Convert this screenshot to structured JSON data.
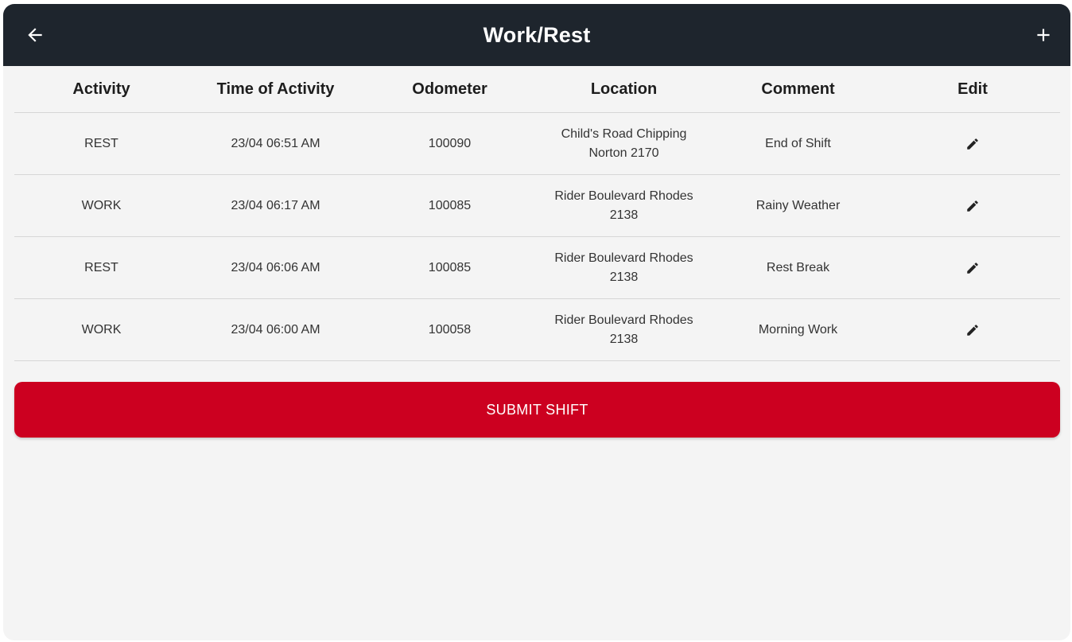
{
  "appbar": {
    "title": "Work/Rest",
    "back_icon": "arrow-left-icon",
    "add_icon": "plus-icon"
  },
  "table": {
    "columns": [
      "Activity",
      "Time of Activity",
      "Odometer",
      "Location",
      "Comment",
      "Edit"
    ],
    "rows": [
      {
        "activity": "REST",
        "time": "23/04 06:51 AM",
        "odometer": "100090",
        "location": "Child's Road Chipping Norton 2170",
        "comment": "End of Shift"
      },
      {
        "activity": "WORK",
        "time": "23/04 06:17 AM",
        "odometer": "100085",
        "location": "Rider Boulevard Rhodes 2138",
        "comment": "Rainy Weather"
      },
      {
        "activity": "REST",
        "time": "23/04 06:06 AM",
        "odometer": "100085",
        "location": "Rider Boulevard Rhodes 2138",
        "comment": "Rest Break"
      },
      {
        "activity": "WORK",
        "time": "23/04 06:00 AM",
        "odometer": "100058",
        "location": "Rider Boulevard Rhodes 2138",
        "comment": "Morning Work"
      }
    ],
    "edit_icon": "pencil-icon"
  },
  "submit": {
    "label": "SUBMIT SHIFT"
  },
  "colors": {
    "appbar_bg": "#1e252d",
    "accent_red": "#cc0020",
    "page_bg": "#f4f4f4"
  }
}
